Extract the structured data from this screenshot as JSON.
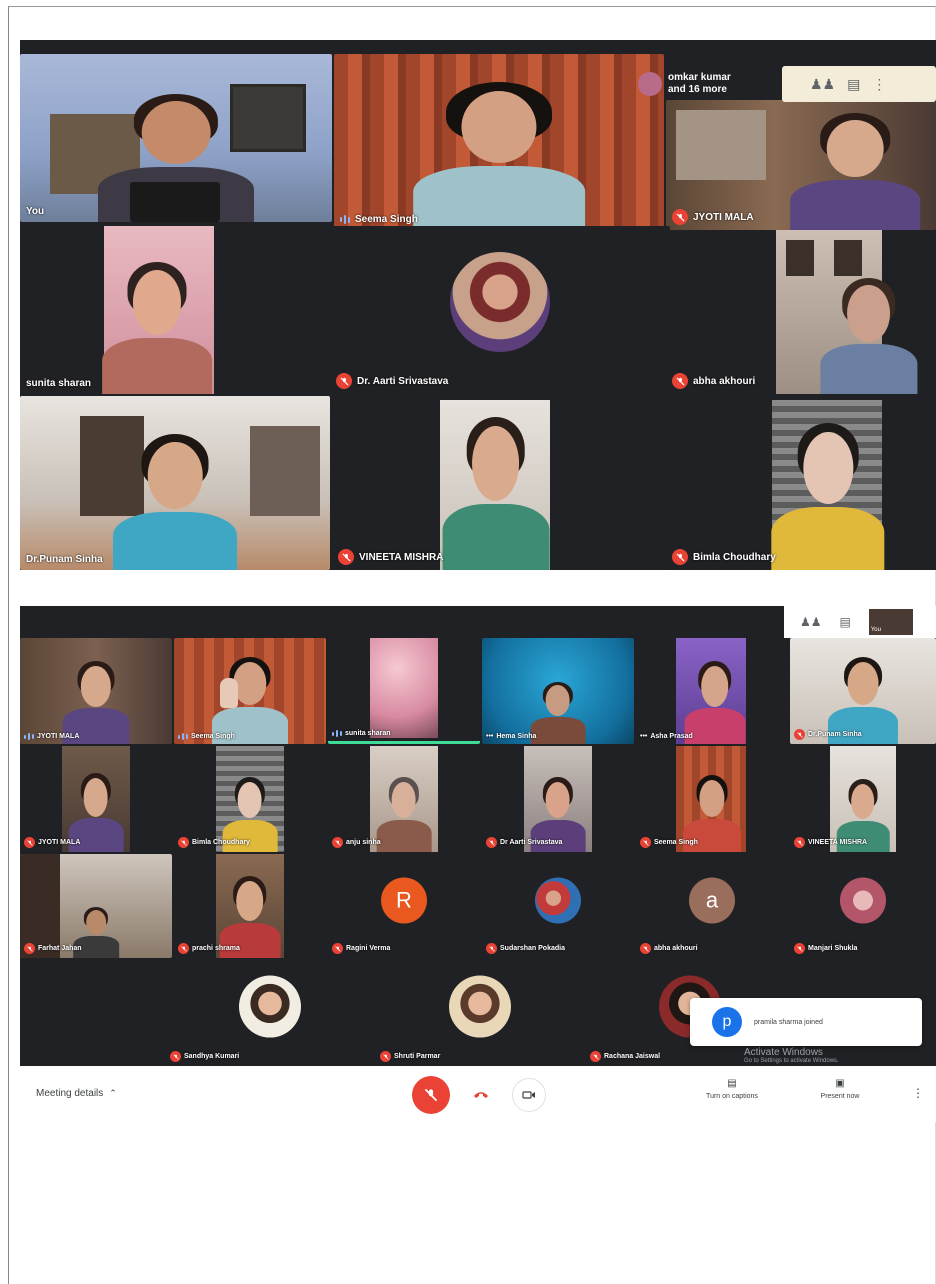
{
  "screenshot1": {
    "header": {
      "joined_text_1": "omkar kumar",
      "joined_text_2": "and 16 more"
    },
    "tiles": [
      {
        "name": "You"
      },
      {
        "name": "Seema Singh"
      },
      {
        "name": "JYOTI MALA"
      },
      {
        "name": "sunita sharan"
      },
      {
        "name": "Dr. Aarti Srivastava"
      },
      {
        "name": "abha akhouri"
      },
      {
        "name": "Dr.Punam Sinha"
      },
      {
        "name": "VINEETA MISHRA"
      },
      {
        "name": "Bimla Choudhary"
      }
    ]
  },
  "screenshot2": {
    "self_label": "You",
    "row1": [
      "JYOTI MALA",
      "Seema Singh",
      "sunita sharan",
      "Hema Sinha",
      "Asha Prasad",
      "Dr.Punam Sinha"
    ],
    "row2": [
      "JYOTI MALA",
      "Bimla Choudhary",
      "anju sinha",
      "Dr Aarti Srivastava",
      "Seema Singh",
      "VINEETA MISHRA"
    ],
    "row3": [
      "Farhat Jahan",
      "prachi shrama",
      "Ragini Verma",
      "Sudarshan Pokadia",
      "abha akhouri",
      "Manjari Shukla"
    ],
    "row3_letters": {
      "ragini": "R",
      "abha": "a"
    },
    "row4": [
      "Sandhya Kumari",
      "Shruti Parmar",
      "Rachana Jaiswal"
    ],
    "toast": {
      "letter": "p",
      "text": "pramila sharma joined"
    },
    "watermark": {
      "line1": "Activate Windows",
      "line2": "Go to Settings to activate Windows."
    },
    "bottom": {
      "meeting_details": "Meeting details",
      "captions_label": "Turn on captions",
      "present_label": "Present now"
    }
  },
  "colors": {
    "dark_bg": "#202124",
    "mic_off": "#ea4335",
    "accent_blue": "#1a73e8"
  }
}
